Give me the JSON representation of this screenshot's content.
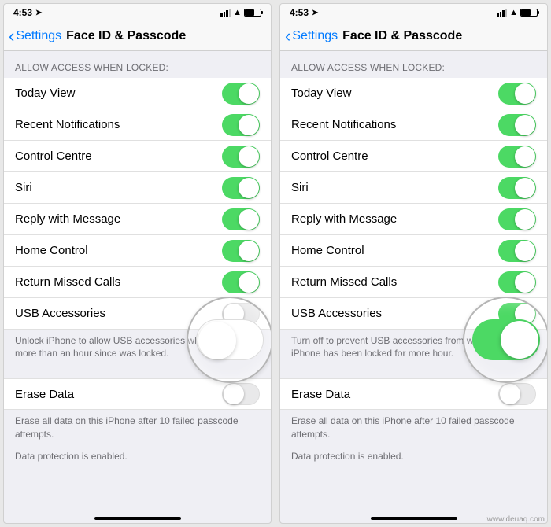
{
  "watermark": "www.deuaq.com",
  "screens": {
    "left": {
      "status": {
        "time": "4:53",
        "location_icon": "➤"
      },
      "nav": {
        "back": "Settings",
        "title": "Face ID & Passcode"
      },
      "section_header": "ALLOW ACCESS WHEN LOCKED:",
      "rows": [
        {
          "label": "Today View",
          "on": true
        },
        {
          "label": "Recent Notifications",
          "on": true
        },
        {
          "label": "Control Centre",
          "on": true
        },
        {
          "label": "Siri",
          "on": true
        },
        {
          "label": "Reply with Message",
          "on": true
        },
        {
          "label": "Home Control",
          "on": true
        },
        {
          "label": "Return Missed Calls",
          "on": true
        },
        {
          "label": "USB Accessories",
          "on": false
        }
      ],
      "usb_footer": "Unlock iPhone to allow USB accessories when it has been more than an hour since was locked.",
      "erase": {
        "label": "Erase Data",
        "on": false
      },
      "erase_footer": "Erase all data on this iPhone after 10 failed passcode attempts.",
      "dp_footer": "Data protection is enabled.",
      "highlight_toggle_on": false
    },
    "right": {
      "status": {
        "time": "4:53",
        "location_icon": "➤"
      },
      "nav": {
        "back": "Settings",
        "title": "Face ID & Passcode"
      },
      "section_header": "ALLOW ACCESS WHEN LOCKED:",
      "rows": [
        {
          "label": "Today View",
          "on": true
        },
        {
          "label": "Recent Notifications",
          "on": true
        },
        {
          "label": "Control Centre",
          "on": true
        },
        {
          "label": "Siri",
          "on": true
        },
        {
          "label": "Reply with Message",
          "on": true
        },
        {
          "label": "Home Control",
          "on": true
        },
        {
          "label": "Return Missed Calls",
          "on": true
        },
        {
          "label": "USB Accessories",
          "on": true
        }
      ],
      "usb_footer": "Turn off to prevent USB accessories from when your iPhone has been locked for more hour.",
      "erase": {
        "label": "Erase Data",
        "on": false
      },
      "erase_footer": "Erase all data on this iPhone after 10 failed passcode attempts.",
      "dp_footer": "Data protection is enabled.",
      "highlight_toggle_on": true
    }
  }
}
